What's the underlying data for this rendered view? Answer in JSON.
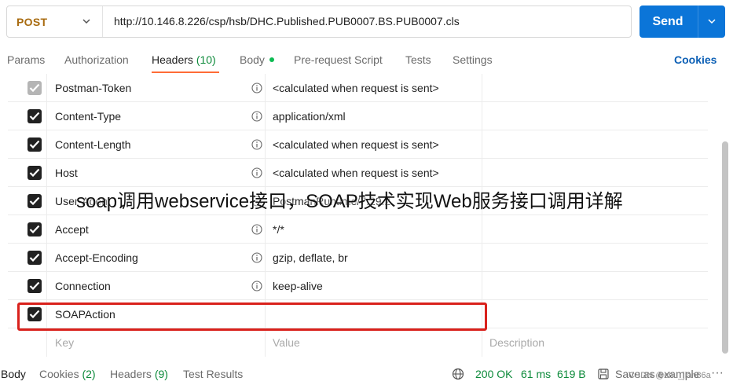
{
  "request": {
    "method": "POST",
    "url": "http://10.146.8.226/csp/hsb/DHC.Published.PUB0007.BS.PUB0007.cls",
    "send_label": "Send"
  },
  "tabs": [
    {
      "label": "Params"
    },
    {
      "label": "Authorization"
    },
    {
      "label": "Headers",
      "count": "(10)"
    },
    {
      "label": "Body"
    },
    {
      "label": "Pre-request Script"
    },
    {
      "label": "Tests"
    },
    {
      "label": "Settings"
    }
  ],
  "cookies_label": "Cookies",
  "headers": [
    {
      "key": "Postman-Token",
      "value": "<calculated when request is sent>",
      "checked": true
    },
    {
      "key": "Content-Type",
      "value": "application/xml",
      "checked": true
    },
    {
      "key": "Content-Length",
      "value": "<calculated when request is sent>",
      "checked": true
    },
    {
      "key": "Host",
      "value": "<calculated when request is sent>",
      "checked": true
    },
    {
      "key": "User-Agent",
      "value": "PostmanRuntime/7.29.2",
      "checked": true
    },
    {
      "key": "Accept",
      "value": "*/*",
      "checked": true
    },
    {
      "key": "Accept-Encoding",
      "value": "gzip, deflate, br",
      "checked": true
    },
    {
      "key": "Connection",
      "value": "keep-alive",
      "checked": true
    },
    {
      "key": "SOAPAction",
      "value": "",
      "checked": true
    }
  ],
  "new_row": {
    "key_placeholder": "Key",
    "value_placeholder": "Value",
    "desc_placeholder": "Description"
  },
  "response": {
    "tabs": [
      {
        "label": "Body"
      },
      {
        "label": "Cookies",
        "count": "(2)"
      },
      {
        "label": "Headers",
        "count": "(9)"
      },
      {
        "label": "Test Results"
      }
    ],
    "status": "200 OK",
    "time": "61 ms",
    "size": "619 B",
    "save_label": "Save as example",
    "more_label": "···"
  },
  "overlay_text": "soap调用webservice接口，SOAP技术实现Web服务接口调用详解",
  "credit_text": "CSDN @chu_jian86a",
  "colors": {
    "accent": "#ff6c37",
    "send": "#0b75d8",
    "highlight": "#d9211c",
    "success": "#0c8a3a"
  }
}
